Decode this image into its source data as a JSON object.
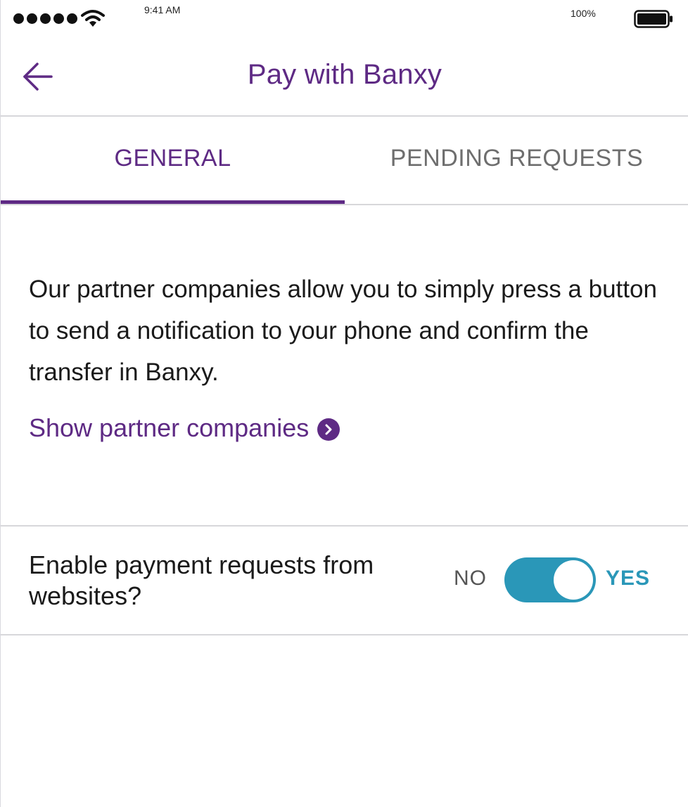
{
  "status_bar": {
    "time": "9:41 AM",
    "battery_percent": "100%",
    "signal_bars": 5
  },
  "header": {
    "title": "Pay with Banxy",
    "back_icon": "arrow-left-icon"
  },
  "tabs": [
    {
      "label": "GENERAL",
      "active": true
    },
    {
      "label": "PENDING REQUESTS",
      "active": false
    }
  ],
  "content": {
    "description": "Our partner companies allow you to simply press a button to send a notification to your phone and confirm the transfer in Banxy.",
    "partner_link": "Show partner companies",
    "partner_link_icon": "chevron-right-circle-icon"
  },
  "setting": {
    "label": "Enable payment requests from websites?",
    "toggle": {
      "off_label": "NO",
      "on_label": "YES",
      "value": true
    }
  },
  "colors": {
    "brand_purple": "#5e2a84",
    "toggle_accent": "#2a97b8",
    "divider": "#d7d7da"
  }
}
